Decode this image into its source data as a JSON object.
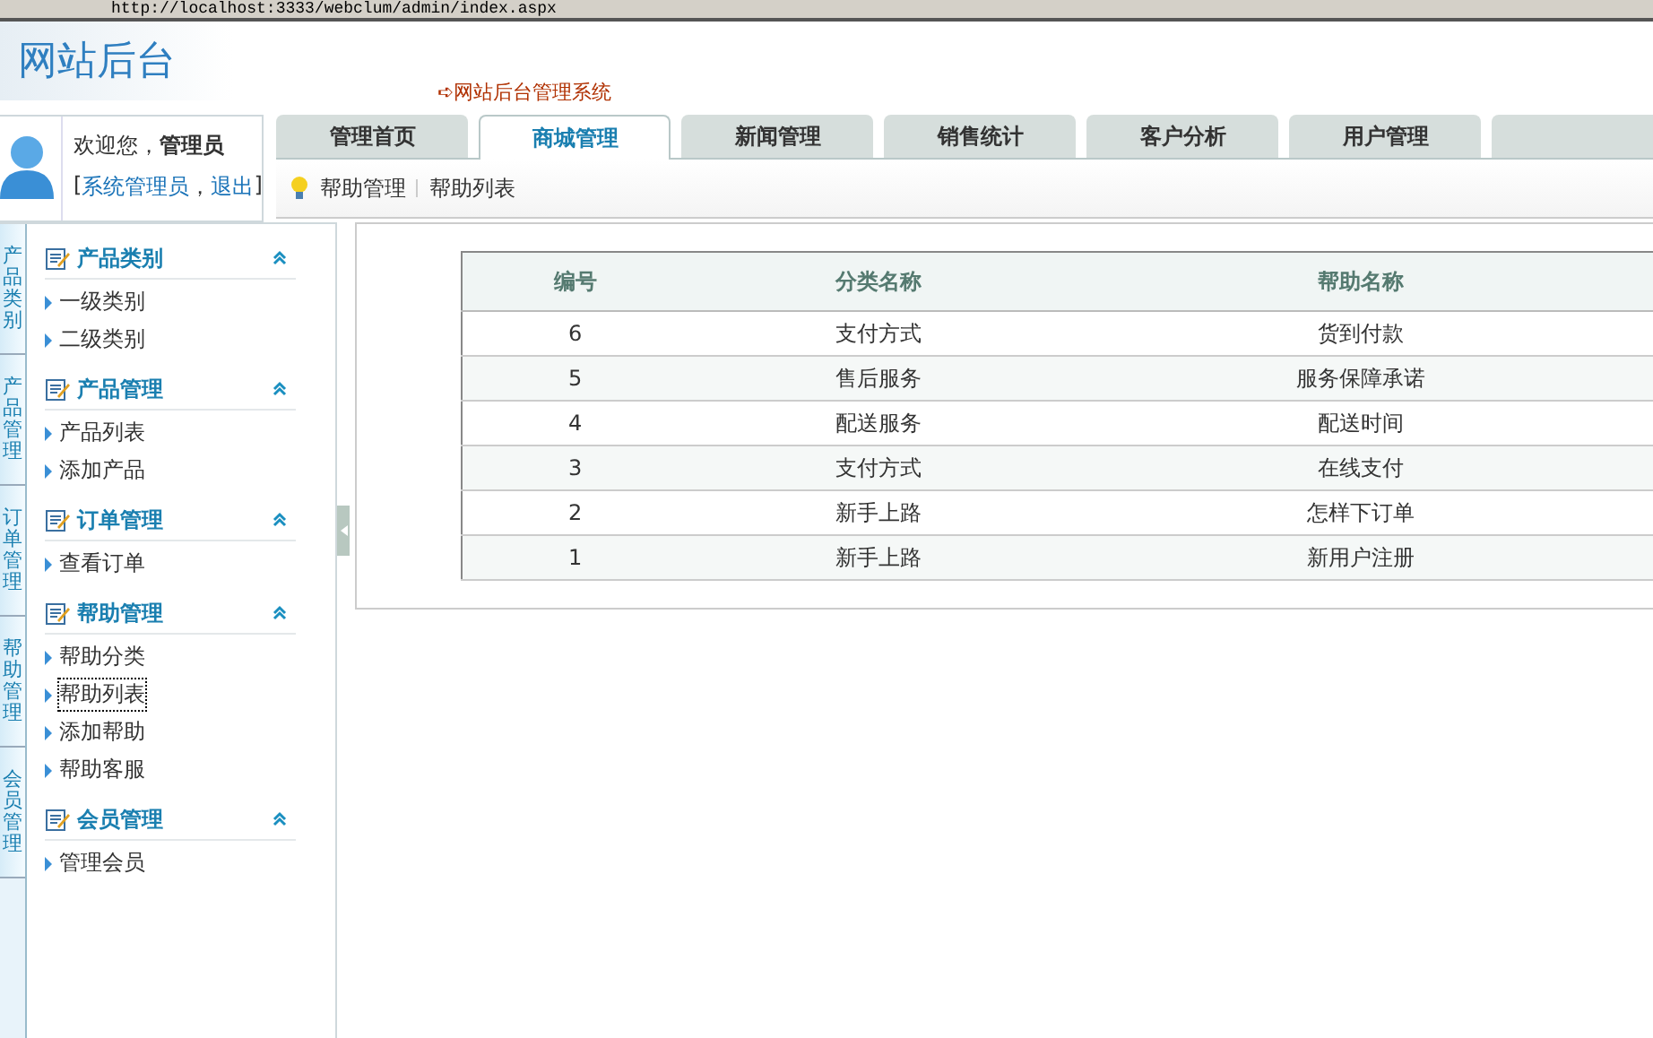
{
  "address_bar": {
    "url": "http://localhost:3333/webclum/admin/index.aspx"
  },
  "header": {
    "logo": "网站后台",
    "subtitle": "➪网站后台管理系统"
  },
  "user_panel": {
    "greeting": "欢迎您，",
    "user": "管理员",
    "open_bracket": "[",
    "role": "系统管理员",
    "separator": "，",
    "logout": "退出",
    "close_bracket": "]"
  },
  "tabs": [
    {
      "label": "管理首页",
      "selected": false
    },
    {
      "label": "商城管理",
      "selected": true
    },
    {
      "label": "新闻管理",
      "selected": false
    },
    {
      "label": "销售统计",
      "selected": false
    },
    {
      "label": "客户分析",
      "selected": false
    },
    {
      "label": "用户管理",
      "selected": false
    },
    {
      "selected": false
    }
  ],
  "breadcrumb": {
    "section": "帮助管理",
    "page": "帮助列表"
  },
  "sidebar": {
    "vertical_tabs": [
      "产品类别",
      "产品管理",
      "订单管理",
      "帮助管理",
      "会员管理"
    ],
    "groups": [
      {
        "title": "产品类别",
        "expanded": true,
        "items": [
          {
            "label": "一级类别",
            "selected": false
          },
          {
            "label": "二级类别",
            "selected": false
          }
        ]
      },
      {
        "title": "产品管理",
        "expanded": true,
        "items": [
          {
            "label": "产品列表",
            "selected": false
          },
          {
            "label": "添加产品",
            "selected": false
          }
        ]
      },
      {
        "title": "订单管理",
        "expanded": true,
        "items": [
          {
            "label": "查看订单",
            "selected": false
          }
        ]
      },
      {
        "title": "帮助管理",
        "expanded": true,
        "items": [
          {
            "label": "帮助分类",
            "selected": false
          },
          {
            "label": "帮助列表",
            "selected": true
          },
          {
            "label": "添加帮助",
            "selected": false
          },
          {
            "label": "帮助客服",
            "selected": false
          }
        ]
      },
      {
        "title": "会员管理",
        "expanded": true,
        "items": [
          {
            "label": "管理会员",
            "selected": false
          }
        ]
      }
    ]
  },
  "table": {
    "columns": [
      "编号",
      "分类名称",
      "帮助名称"
    ],
    "rows": [
      [
        "6",
        "支付方式",
        "货到付款"
      ],
      [
        "5",
        "售后服务",
        "服务保障承诺"
      ],
      [
        "4",
        "配送服务",
        "配送时间"
      ],
      [
        "3",
        "支付方式",
        "在线支付"
      ],
      [
        "2",
        "新手上路",
        "怎样下订单"
      ],
      [
        "1",
        "新手上路",
        "新用户注册"
      ]
    ]
  }
}
